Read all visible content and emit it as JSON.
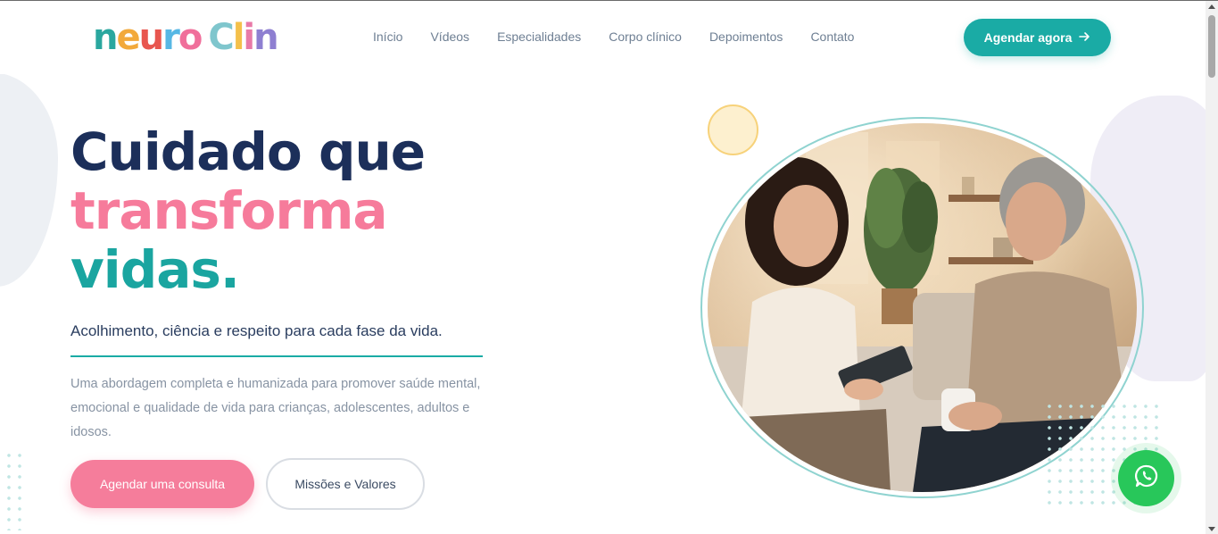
{
  "brand": {
    "logo_letters": [
      "n",
      "e",
      "u",
      "r",
      "o",
      " ",
      "C",
      "l",
      "i",
      "n"
    ],
    "logo_colors": [
      "#2aa79f",
      "#f2a93b",
      "#e8564f",
      "#57b7e4",
      "#f06f9b",
      "#ffffff",
      "#7fc6cd",
      "#f4c04a",
      "#e87aa8",
      "#8e7fd1"
    ]
  },
  "nav": {
    "items": [
      "Início",
      "Vídeos",
      "Especialidades",
      "Corpo clínico",
      "Depoimentos",
      "Contato"
    ],
    "cta_label": "Agendar agora",
    "cta_icon": "arrow-right-icon"
  },
  "hero": {
    "line1": "Cuidado que",
    "line2": "transforma",
    "line3": "vidas.",
    "tagline": "Acolhimento, ciência e respeito para cada fase da vida.",
    "description": "Uma abordagem completa e humanizada para promover saúde mental, emocional e qualidade de vida para crianças, adolescentes, adultos e idosos.",
    "primary_button": "Agendar uma consulta",
    "secondary_button": "Missões e Valores"
  },
  "photo": {
    "alt_icon": "therapy-session-photo"
  },
  "floating": {
    "whatsapp_icon": "whatsapp-icon"
  },
  "colors": {
    "accent_teal": "#1aaba5",
    "accent_pink": "#f67b9b",
    "navy": "#1c2f5a"
  }
}
